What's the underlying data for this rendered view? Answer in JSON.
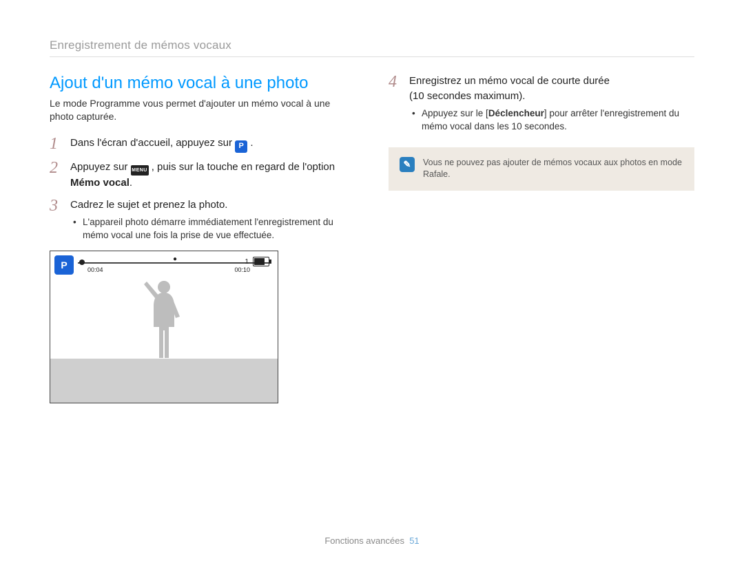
{
  "header": {
    "breadcrumb": "Enregistrement de mémos vocaux"
  },
  "left": {
    "title": "Ajout d'un mémo vocal à une photo",
    "intro": "Le mode Programme vous permet d'ajouter un mémo vocal à une photo capturée.",
    "step1": {
      "num": "1",
      "text_before_icon": "Dans l'écran d'accueil, appuyez sur ",
      "icon_label": "P",
      "text_after_icon": "."
    },
    "step2": {
      "num": "2",
      "text_before": "Appuyez sur ",
      "menu_label": "MENU",
      "text_mid": ", puis sur la touche en regard de l'option ",
      "bold": "Mémo vocal",
      "text_after": "."
    },
    "step3": {
      "num": "3",
      "text": "Cadrez le sujet et prenez la photo.",
      "bullet": "L'appareil photo démarre immédiatement l'enregistrement du mémo vocal une fois la prise de vue effectuée."
    },
    "camera": {
      "p_badge": "P",
      "time_left": "00:04",
      "time_right": "00:10",
      "one": "1"
    }
  },
  "right": {
    "step4": {
      "num": "4",
      "line1": "Enregistrez un mémo vocal de courte durée",
      "line2": "(10 secondes maximum).",
      "bullet_before": "Appuyez sur le [",
      "bullet_bold": "Déclencheur",
      "bullet_after": "] pour arrêter l'enregistrement du mémo vocal dans les 10 secondes."
    },
    "note": {
      "icon": "✎",
      "text": "Vous ne pouvez pas ajouter de mémos vocaux aux photos en mode Rafale."
    }
  },
  "footer": {
    "section": "Fonctions avancées",
    "page": "51"
  }
}
